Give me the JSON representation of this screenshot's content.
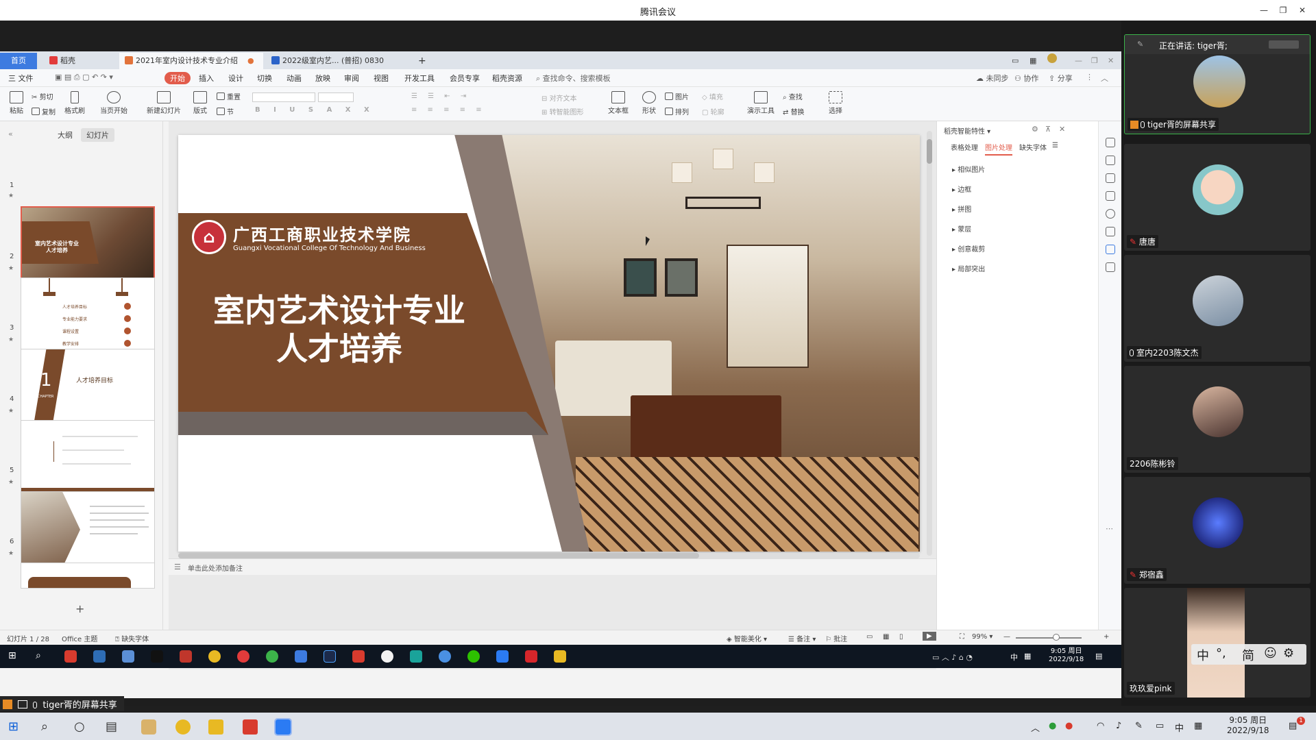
{
  "meeting": {
    "title": "腾讯会议",
    "speaking_label": "正在讲话: tiger胥;",
    "share_label": "tiger胥的屏幕共享"
  },
  "wps": {
    "tabs": [
      {
        "label": "首页"
      },
      {
        "label": "稻壳"
      },
      {
        "label": "2021年室内设计技术专业介绍"
      },
      {
        "label": "2022级室内艺... (普招) 0830"
      }
    ],
    "add_tab": "+",
    "menu": {
      "file": "三 文件",
      "items": [
        "开始",
        "插入",
        "设计",
        "切换",
        "动画",
        "放映",
        "审阅",
        "视图",
        "开发工具",
        "会员专享",
        "稻壳资源"
      ],
      "search": "查找命令、搜索模板",
      "right": [
        "未同步",
        "协作",
        "分享"
      ]
    },
    "ribbon": {
      "paste": "粘贴",
      "cut": "剪切",
      "copy": "复制",
      "format_painter": "格式刷",
      "from_current": "当页开始",
      "new_slide": "新建幻灯片",
      "layout": "版式",
      "section": "节",
      "reset": "重置",
      "align_text": "对齐文本",
      "smart_graphic": "转智能图形",
      "textbox": "文本框",
      "shape": "形状",
      "picture": "图片",
      "fill": "填充",
      "arrange": "排列",
      "outline": "轮廓",
      "present_tools": "演示工具",
      "find": "查找",
      "replace": "替换",
      "select": "选择"
    },
    "panel_tabs": [
      "大纲",
      "幻灯片"
    ],
    "slides": [
      {
        "num": "1"
      },
      {
        "num": "2"
      },
      {
        "num": "3",
        "chapter_num": "1",
        "chapter_word": "CHAPTER",
        "title": "人才培养目标"
      },
      {
        "num": "4"
      },
      {
        "num": "5"
      },
      {
        "num": "6"
      }
    ],
    "thumb2_items": [
      "人才培养目标",
      "专业能力要求",
      "课程设置",
      "教学安排"
    ],
    "add_slide": "+",
    "main_slide": {
      "college_cn": "广西工商职业技术学院",
      "college_en": "Guangxi Vocational College Of Technology And Business",
      "title_line1": "室内艺术设计专业",
      "title_line2": "人才培养"
    },
    "notes_placeholder": "单击此处添加备注",
    "smart_panel": {
      "title": "稻壳智能特性",
      "tabs": [
        "表格处理",
        "图片处理",
        "缺失字体"
      ],
      "items": [
        "相似图片",
        "边框",
        "拼图",
        "蒙层",
        "创意裁剪",
        "局部突出"
      ]
    },
    "status": {
      "slide_count": "幻灯片 1 / 28",
      "theme": "Office 主题",
      "missing_font": "缺失字体",
      "beautify": "智能美化",
      "notes": "备注",
      "comments": "批注",
      "zoom": "99%"
    },
    "remote_tray": {
      "ime": "中",
      "time": "9:05 周日",
      "date": "2022/9/18"
    }
  },
  "participants": [
    {
      "name": "tiger胥的屏幕共享"
    },
    {
      "name": "唐唐"
    },
    {
      "name": "室内2203陈文杰"
    },
    {
      "name": "2206陈彬铃"
    },
    {
      "name": "郑宿鑫"
    },
    {
      "name": "玖玖爱pink"
    }
  ],
  "ime_toolbar": [
    "中",
    "°,",
    "简"
  ],
  "host_tray": {
    "ime": "中",
    "time": "9:05 周日",
    "date": "2022/9/18",
    "notification_count": "1"
  },
  "colors": {
    "slide_brown": "#7a4a2b",
    "tab_active_red": "#e25c4b",
    "remote_taskbar": "#0e1621",
    "participant_bg": "#2b2b2b"
  }
}
